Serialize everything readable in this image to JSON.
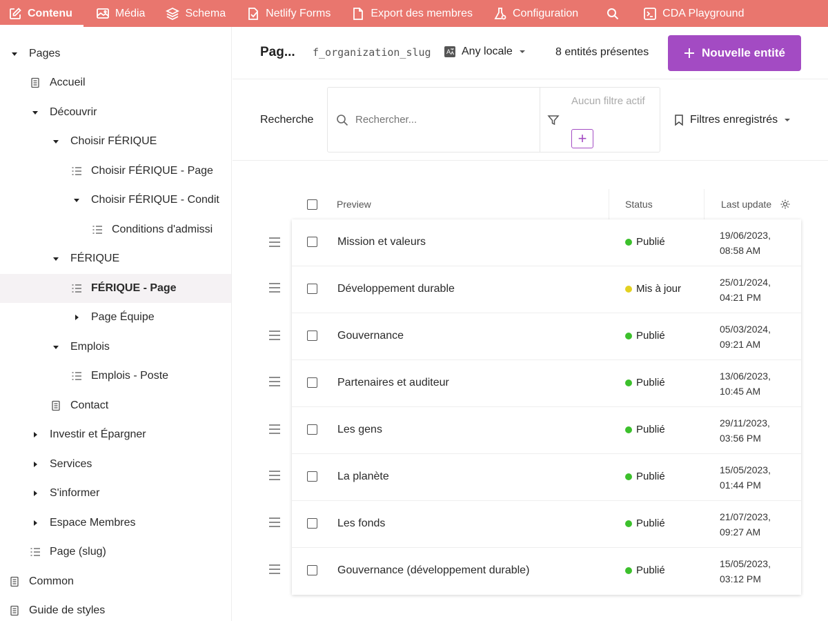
{
  "nav": {
    "items": [
      {
        "label": "Contenu",
        "icon": "edit-icon",
        "active": true
      },
      {
        "label": "Média",
        "icon": "image-icon"
      },
      {
        "label": "Schema",
        "icon": "layers-icon"
      },
      {
        "label": "Netlify Forms",
        "icon": "form-icon"
      },
      {
        "label": "Export des membres",
        "icon": "document-icon"
      },
      {
        "label": "Configuration",
        "icon": "flask-icon"
      },
      {
        "label": "CDA Playground",
        "icon": "terminal-icon"
      }
    ],
    "search_icon": "search-icon"
  },
  "sidebar": {
    "items": [
      {
        "label": "Pages",
        "icon": "caret-down-icon",
        "indent": 0
      },
      {
        "label": "Accueil",
        "icon": "page-icon",
        "indent": 1
      },
      {
        "label": "Découvrir",
        "icon": "caret-down-icon",
        "indent": 1
      },
      {
        "label": "Choisir FÉRIQUE",
        "icon": "caret-down-icon",
        "indent": 2
      },
      {
        "label": "Choisir FÉRIQUE - Page",
        "icon": "list-icon",
        "indent": 3
      },
      {
        "label": "Choisir FÉRIQUE - Condit",
        "icon": "caret-down-icon",
        "indent": 3
      },
      {
        "label": "Conditions d'admissi",
        "icon": "list-icon",
        "indent": 4
      },
      {
        "label": "FÉRIQUE",
        "icon": "caret-down-icon",
        "indent": 2
      },
      {
        "label": "FÉRIQUE - Page",
        "icon": "list-icon",
        "indent": 3,
        "selected": true
      },
      {
        "label": "Page Équipe",
        "icon": "caret-right-icon",
        "indent": 3
      },
      {
        "label": "Emplois",
        "icon": "caret-down-icon",
        "indent": 2
      },
      {
        "label": "Emplois - Poste",
        "icon": "list-icon",
        "indent": 3
      },
      {
        "label": "Contact",
        "icon": "page-icon",
        "indent": 2
      },
      {
        "label": "Investir et Épargner",
        "icon": "caret-right-icon",
        "indent": 1
      },
      {
        "label": "Services",
        "icon": "caret-right-icon",
        "indent": 1
      },
      {
        "label": "S'informer",
        "icon": "caret-right-icon",
        "indent": 1
      },
      {
        "label": "Espace Membres",
        "icon": "caret-right-icon",
        "indent": 1
      },
      {
        "label": "Page (slug)",
        "icon": "list-icon",
        "indent": 1
      },
      {
        "label": "Common",
        "icon": "page-icon",
        "indent": 0
      },
      {
        "label": "Guide de styles",
        "icon": "page-icon",
        "indent": 0
      }
    ]
  },
  "header": {
    "title": "Pag...",
    "slug": "f_organization_slug",
    "locale": "Any locale",
    "count": "8 entités présentes",
    "new_button": "Nouvelle entité"
  },
  "search": {
    "label": "Recherche",
    "placeholder": "Rechercher...",
    "no_filter": "Aucun filtre actif",
    "add_filter": "+",
    "saved_filters": "Filtres enregistrés"
  },
  "table": {
    "columns": {
      "preview": "Preview",
      "status": "Status",
      "last_update": "Last update"
    },
    "status_colors": {
      "Publié": "#3cc02c",
      "Mis à jour": "#e3d121"
    },
    "rows": [
      {
        "preview": "Mission et valeurs",
        "status": "Publié",
        "date": "19/06/2023,",
        "time": "08:58 AM"
      },
      {
        "preview": "Développement durable",
        "status": "Mis à jour",
        "date": "25/01/2024,",
        "time": "04:21 PM"
      },
      {
        "preview": "Gouvernance",
        "status": "Publié",
        "date": "05/03/2024,",
        "time": "09:21 AM"
      },
      {
        "preview": "Partenaires et auditeur",
        "status": "Publié",
        "date": "13/06/2023,",
        "time": "10:45 AM"
      },
      {
        "preview": "Les gens",
        "status": "Publié",
        "date": "29/11/2023,",
        "time": "03:56 PM"
      },
      {
        "preview": "La planète",
        "status": "Publié",
        "date": "15/05/2023,",
        "time": "01:44 PM"
      },
      {
        "preview": "Les fonds",
        "status": "Publié",
        "date": "21/07/2023,",
        "time": "09:27 AM"
      },
      {
        "preview": "Gouvernance (développement durable)",
        "status": "Publié",
        "date": "15/05/2023,",
        "time": "03:12 PM"
      }
    ]
  }
}
